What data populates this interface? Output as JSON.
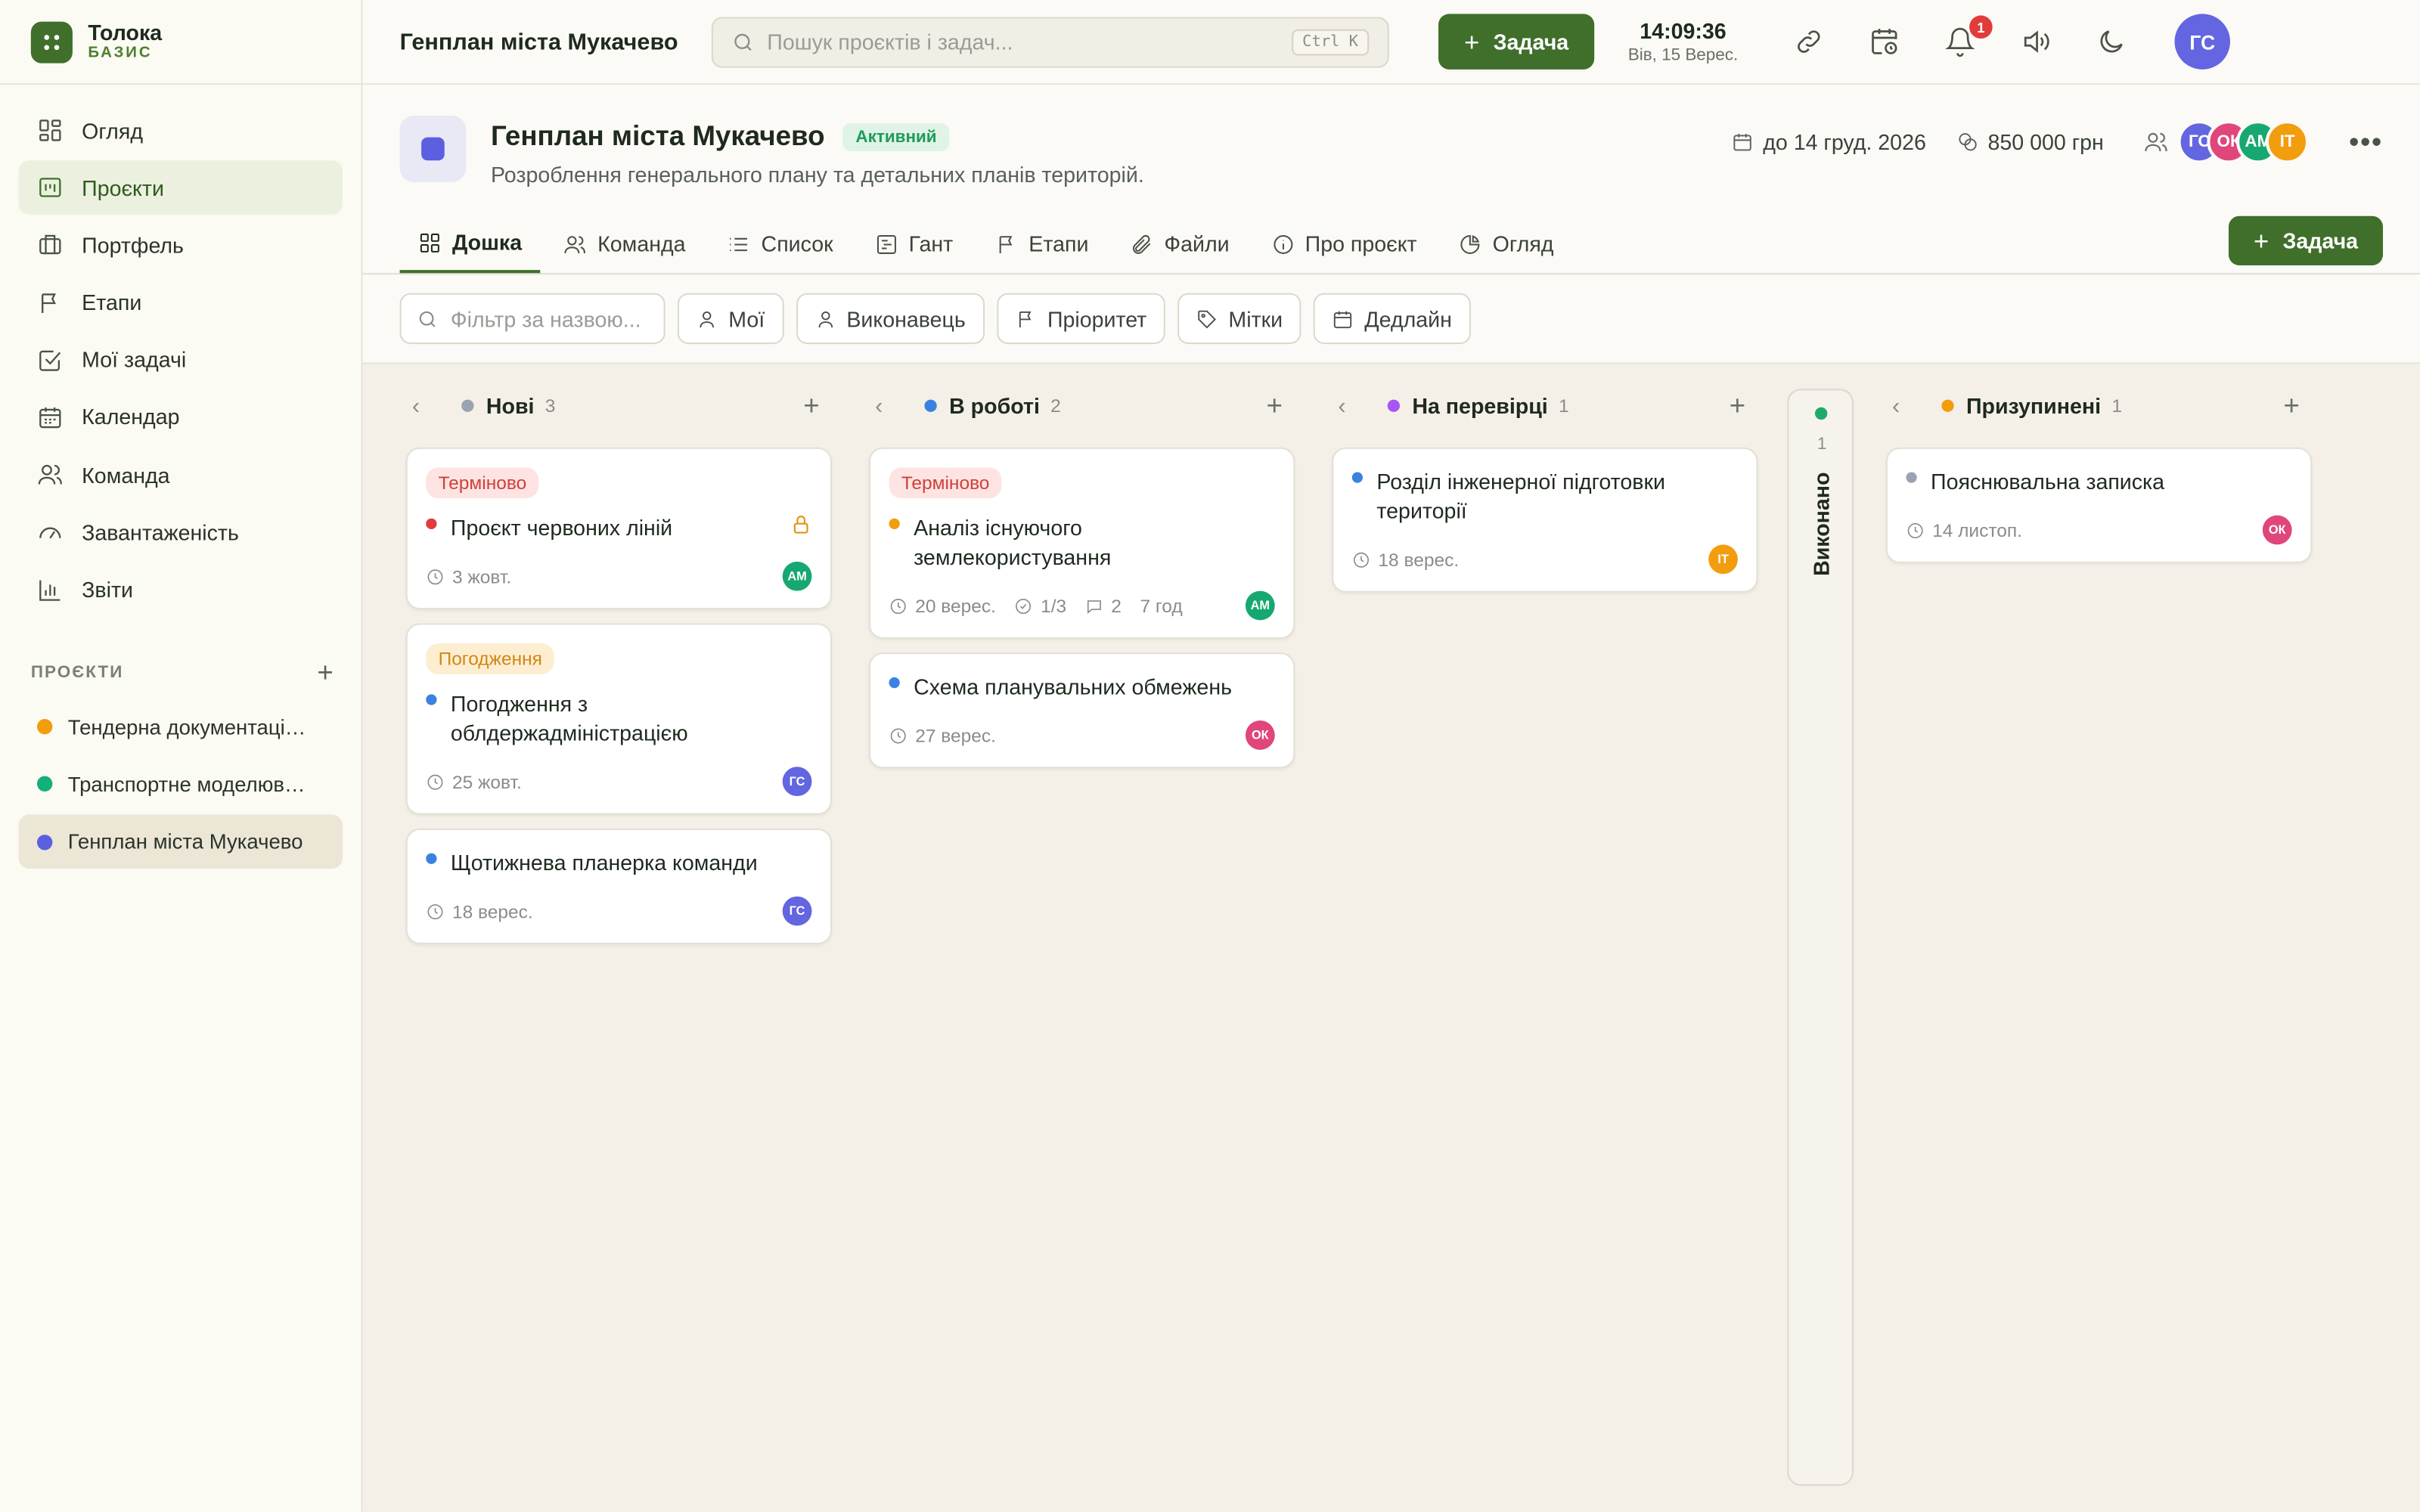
{
  "brand": {
    "name": "Толока",
    "plan": "БАЗИС"
  },
  "nav": [
    {
      "label": "Огляд",
      "icon": "grid-icon"
    },
    {
      "label": "Проєкти",
      "icon": "projects-icon",
      "active": true
    },
    {
      "label": "Портфель",
      "icon": "briefcase-icon"
    },
    {
      "label": "Етапи",
      "icon": "flag-icon"
    },
    {
      "label": "Мої задачі",
      "icon": "checkbox-icon"
    },
    {
      "label": "Календар",
      "icon": "calendar-icon"
    },
    {
      "label": "Команда",
      "icon": "users-icon"
    },
    {
      "label": "Завантаженість",
      "icon": "gauge-icon"
    },
    {
      "label": "Звіти",
      "icon": "bar-chart-icon"
    }
  ],
  "projects_section": {
    "title": "ПРОЄКТИ",
    "add": "+"
  },
  "projects": [
    {
      "label": "Тендерна документаці…",
      "color": "#f29d0e"
    },
    {
      "label": "Транспортне моделюв…",
      "color": "#12b07a"
    },
    {
      "label": "Генплан міста Мукачево",
      "color": "#5b5fe0",
      "active": true
    }
  ],
  "topbar": {
    "breadcrumb": "Генплан міста Мукачево",
    "search_placeholder": "Пошук проєктів і задач...",
    "search_shortcut": "Ctrl K",
    "task_button": "Задача",
    "time": "14:09:36",
    "date": "Вів, 15 Верес.",
    "notification_count": "1",
    "user_initials": "ГС"
  },
  "project": {
    "title": "Генплан міста Мукачево",
    "status": "Активний",
    "description": "Розроблення генерального плану та детальних планів територій.",
    "deadline": "до 14 груд. 2026",
    "budget": "850 000 грн",
    "members": [
      {
        "initials": "ГС",
        "color": "#6366e0"
      },
      {
        "initials": "ОК",
        "color": "#e0457b"
      },
      {
        "initials": "АМ",
        "color": "#17a872"
      },
      {
        "initials": "ІТ",
        "color": "#f29d0e"
      }
    ],
    "more": "•••",
    "task_button": "Задача"
  },
  "tabs": [
    {
      "label": "Дошка",
      "icon": "board-icon",
      "active": true
    },
    {
      "label": "Команда",
      "icon": "users-icon"
    },
    {
      "label": "Список",
      "icon": "list-icon"
    },
    {
      "label": "Гант",
      "icon": "gantt-icon"
    },
    {
      "label": "Етапи",
      "icon": "flag-icon"
    },
    {
      "label": "Файли",
      "icon": "paperclip-icon"
    },
    {
      "label": "Про проєкт",
      "icon": "info-icon"
    },
    {
      "label": "Огляд",
      "icon": "pie-icon"
    }
  ],
  "filters": {
    "search_placeholder": "Фільтр за назвою...",
    "buttons": [
      {
        "label": "Мої",
        "icon": "user-icon"
      },
      {
        "label": "Виконавець",
        "icon": "user-icon"
      },
      {
        "label": "Пріоритет",
        "icon": "flag-icon"
      },
      {
        "label": "Мітки",
        "icon": "tag-icon"
      },
      {
        "label": "Дедлайн",
        "icon": "calendar-icon"
      }
    ]
  },
  "columns": [
    {
      "name": "Нові",
      "count": "3",
      "color": "#9aa3b0",
      "cards": [
        {
          "label": "Терміново",
          "label_type": "urgent",
          "title": "Проєкт червоних ліній",
          "priority_color": "#e23b3b",
          "locked": true,
          "date": "3 жовт.",
          "assignee": "АМ",
          "assignee_color": "#17a872"
        },
        {
          "label": "Погодження",
          "label_type": "approve",
          "title": "Погодження з облдержадміністрацією",
          "priority_color": "#3b82e0",
          "date": "25 жовт.",
          "assignee": "ГС",
          "assignee_color": "#6366e0"
        },
        {
          "title": "Щотижнева планерка команди",
          "priority_color": "#3b82e0",
          "date": "18 верес.",
          "assignee": "ГС",
          "assignee_color": "#6366e0"
        }
      ]
    },
    {
      "name": "В роботі",
      "count": "2",
      "color": "#3b82e0",
      "cards": [
        {
          "label": "Терміново",
          "label_type": "urgent",
          "title": "Аналіз існуючого землекористування",
          "priority_color": "#f29d0e",
          "date": "20 верес.",
          "subtasks": "1/3",
          "comments": "2",
          "time": "7 год",
          "assignee": "АМ",
          "assignee_color": "#17a872"
        },
        {
          "title": "Схема планувальних обмежень",
          "priority_color": "#3b82e0",
          "date": "27 верес.",
          "assignee": "ОК",
          "assignee_color": "#e0457b"
        }
      ]
    },
    {
      "name": "На перевірці",
      "count": "1",
      "color": "#a855f7",
      "cards": [
        {
          "title": "Розділ інженерної підготовки території",
          "priority_color": "#3b82e0",
          "date": "18 верес.",
          "assignee": "ІТ",
          "assignee_color": "#f29d0e"
        }
      ]
    },
    {
      "name": "Призупинені",
      "count": "1",
      "color": "#f29d0e",
      "cards": [
        {
          "title": "Пояснювальна записка",
          "priority_color": "#9aa3b0",
          "date": "14 листоп.",
          "assignee": "ОК",
          "assignee_color": "#e0457b"
        }
      ]
    }
  ],
  "collapsed_column": {
    "name": "Виконано",
    "count": "1",
    "color": "#1faa6b"
  }
}
